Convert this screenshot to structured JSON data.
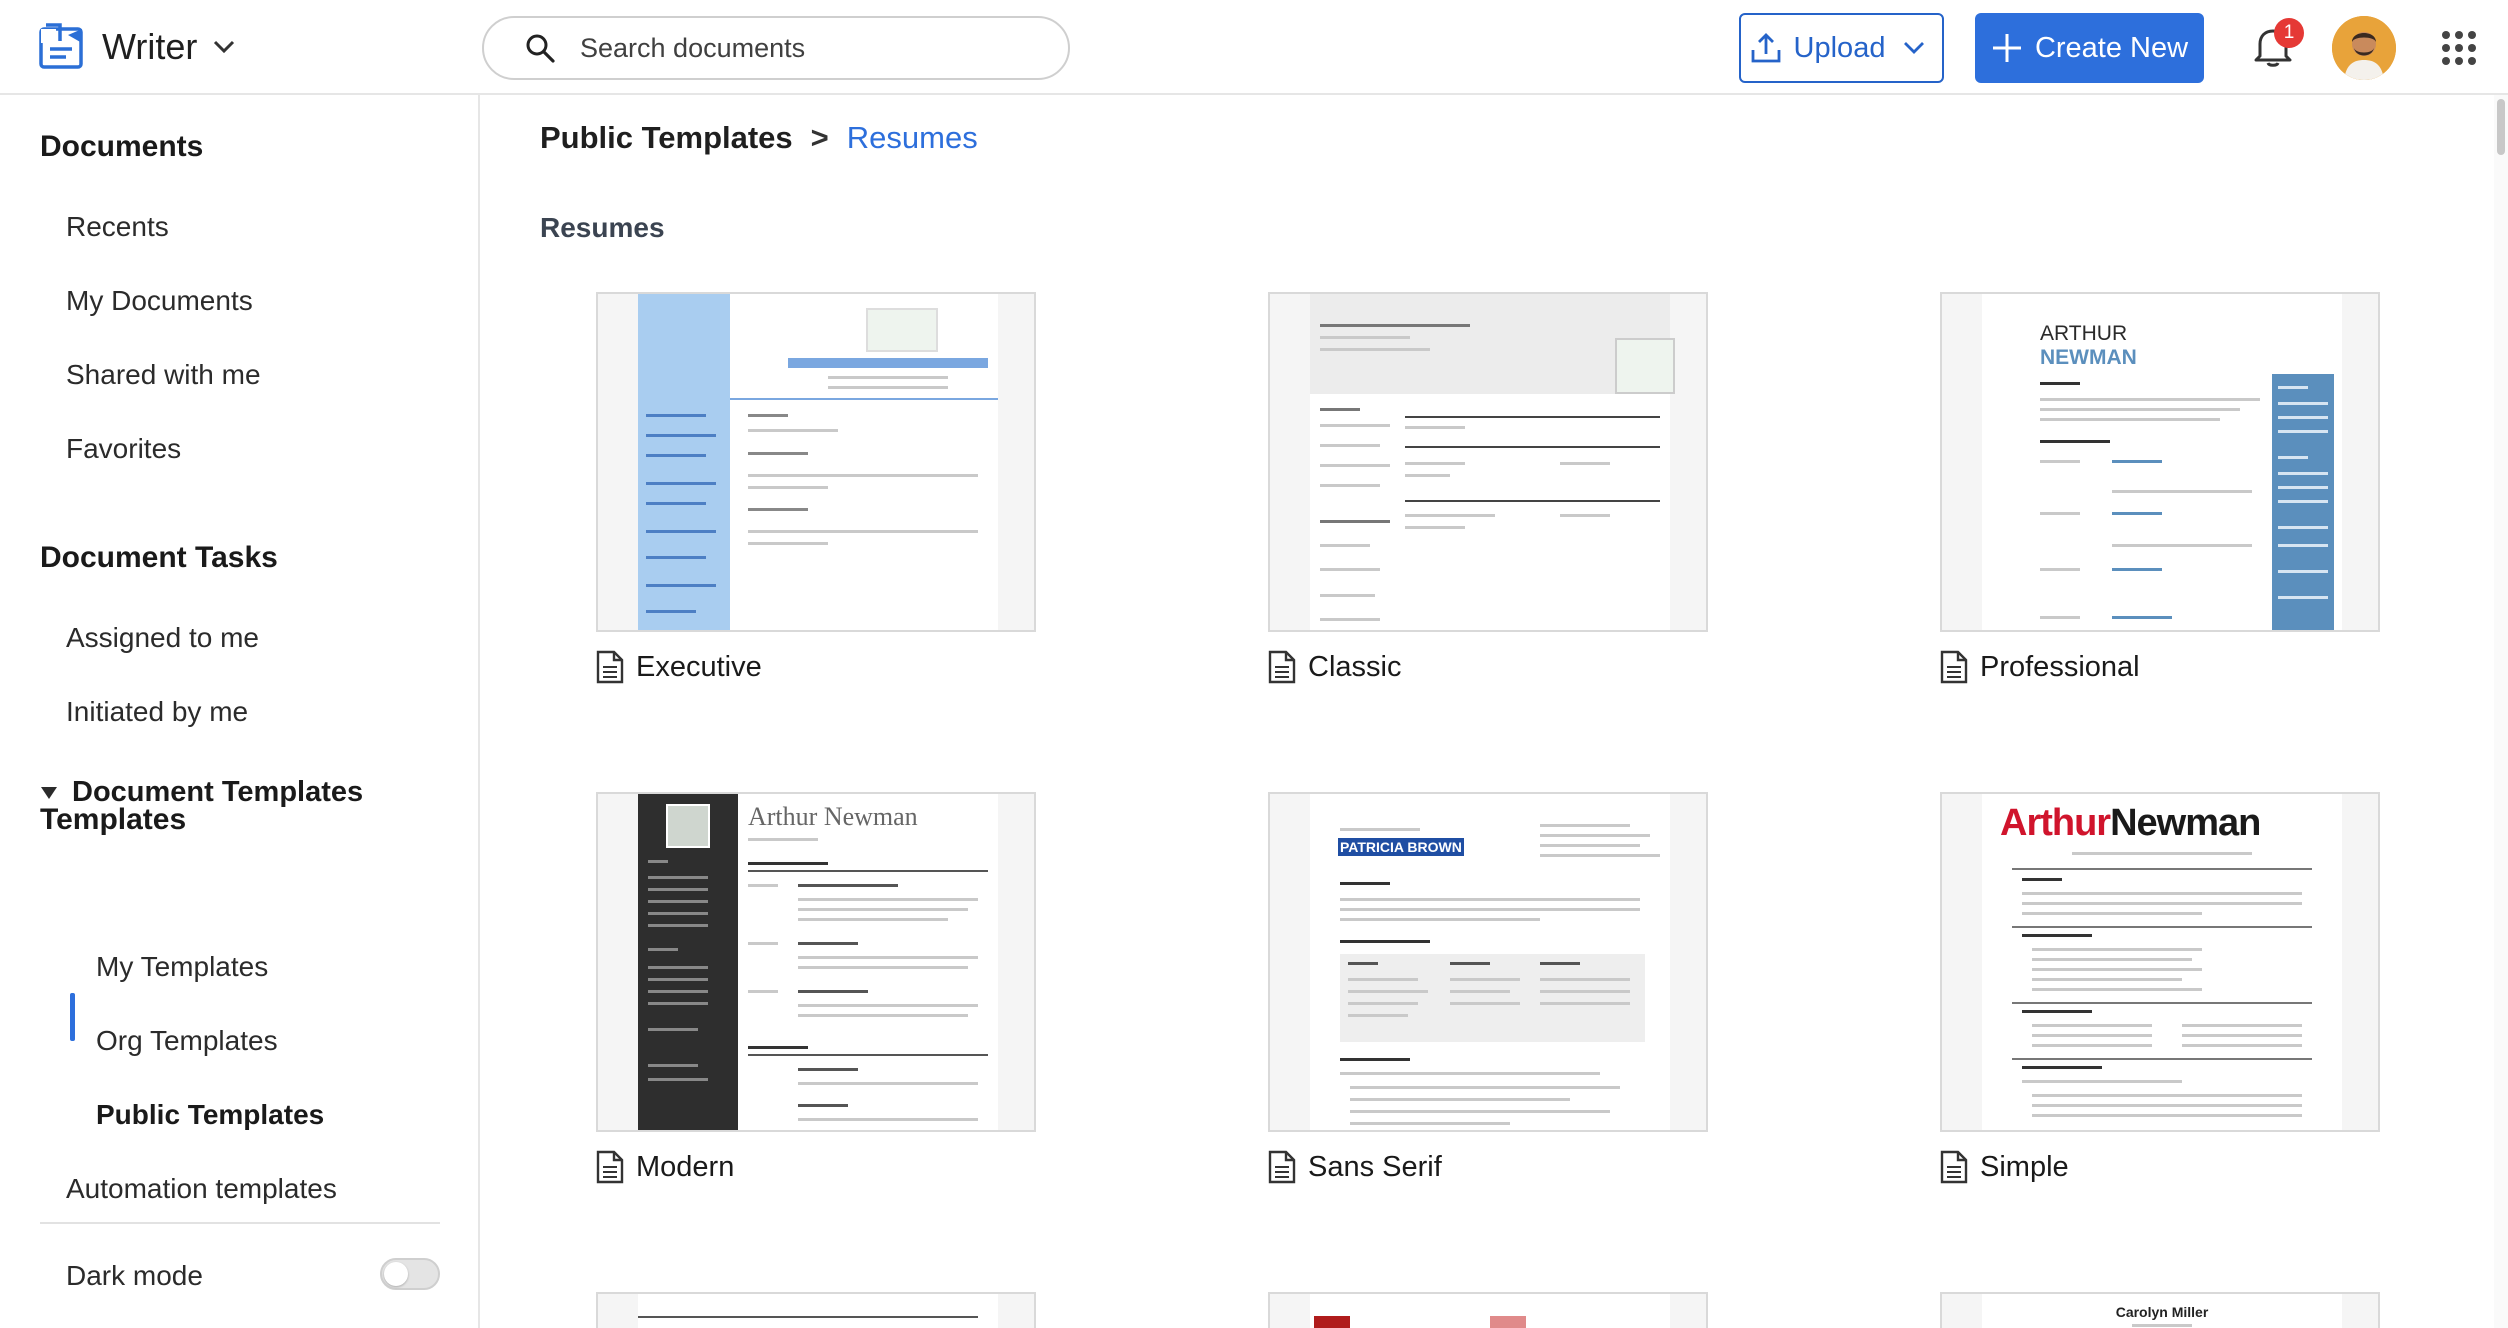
{
  "app": {
    "name": "Writer"
  },
  "search": {
    "placeholder": "Search documents"
  },
  "header": {
    "upload_label": "Upload",
    "create_label": "Create New",
    "notification_count": "1"
  },
  "sidebar": {
    "documents_title": "Documents",
    "documents": [
      "Recents",
      "My Documents",
      "Shared with me",
      "Favorites"
    ],
    "tasks_title": "Document Tasks",
    "tasks": [
      "Assigned to me",
      "Initiated by me"
    ],
    "templates_title": "Templates",
    "document_templates": "Document Templates",
    "template_items": [
      "My Templates",
      "Org Templates",
      "Public Templates"
    ],
    "automation": "Automation templates",
    "dark_mode": "Dark mode"
  },
  "breadcrumb": {
    "parent": "Public Templates",
    "separator": ">",
    "current": "Resumes"
  },
  "section_title": "Resumes",
  "templates": [
    {
      "name": "Executive"
    },
    {
      "name": "Classic"
    },
    {
      "name": "Professional",
      "preview_name_1": "ARTHUR",
      "preview_name_2": "NEWMAN"
    },
    {
      "name": "Modern",
      "preview_name": "Arthur Newman"
    },
    {
      "name": "Sans Serif",
      "preview_name": "PATRICIA BROWN"
    },
    {
      "name": "Simple",
      "preview_name_1": "Arthur",
      "preview_name_2": "Newman"
    }
  ],
  "partial_row": {
    "preview_1": "Carolyn Miller"
  },
  "colors": {
    "accent": "#2d6fdc",
    "badge": "#e53935",
    "executive_side": "#a9cdf0",
    "professional_side": "#5b8fbd",
    "simple_red": "#d0142c"
  }
}
